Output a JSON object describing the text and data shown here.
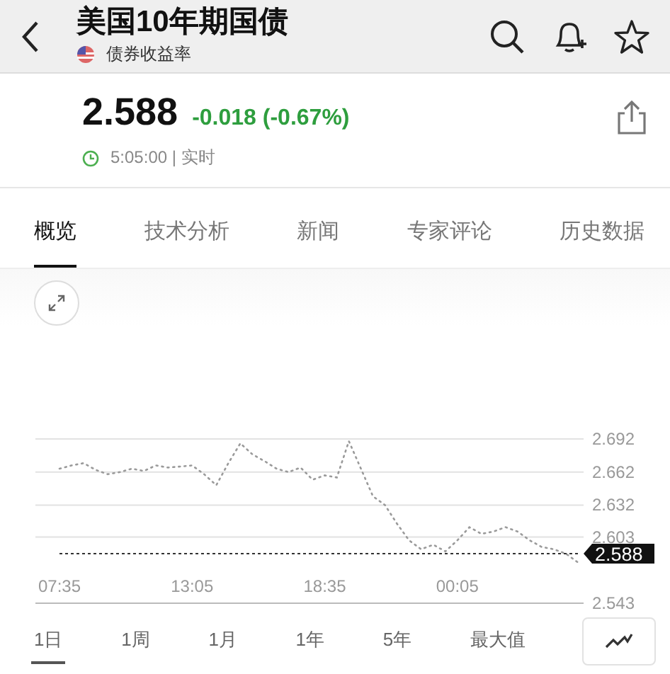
{
  "header": {
    "title": "美国10年期国债",
    "subtitle": "债券收益率"
  },
  "quote": {
    "price": "2.588",
    "change": "-0.018 (-0.67%)",
    "time": "5:05:00 | 实时"
  },
  "tabs": [
    {
      "label": "概览",
      "selected": true
    },
    {
      "label": "技术分析",
      "selected": false
    },
    {
      "label": "新闻",
      "selected": false
    },
    {
      "label": "专家评论",
      "selected": false
    },
    {
      "label": "历史数据",
      "selected": false
    }
  ],
  "chart_data": {
    "type": "line",
    "grid": true,
    "categories": [
      "07:35",
      null,
      null,
      null,
      null,
      null,
      null,
      null,
      null,
      null,
      null,
      "13:05",
      null,
      null,
      null,
      null,
      null,
      null,
      null,
      null,
      null,
      null,
      "18:35",
      null,
      null,
      null,
      null,
      null,
      null,
      null,
      null,
      null,
      null,
      "00:05",
      null,
      null,
      null,
      null,
      null,
      null,
      null,
      null,
      null,
      null
    ],
    "series": [
      {
        "color": "#9a9a9a",
        "line_style": "dotted",
        "values": [
          2.665,
          2.668,
          2.67,
          2.664,
          2.66,
          2.662,
          2.665,
          2.663,
          2.668,
          2.666,
          2.667,
          2.668,
          2.66,
          2.65,
          2.67,
          2.688,
          2.678,
          2.672,
          2.665,
          2.662,
          2.666,
          2.655,
          2.659,
          2.657,
          2.69,
          2.665,
          2.64,
          2.632,
          2.615,
          2.6,
          2.592,
          2.596,
          2.59,
          2.6,
          2.612,
          2.606,
          2.608,
          2.612,
          2.608,
          2.6,
          2.594,
          2.592,
          2.588,
          2.58
        ]
      },
      {
        "color": "#333333",
        "line_style": "dashed",
        "values": [
          2.588,
          2.588,
          2.588,
          2.588,
          2.588,
          2.588,
          2.588,
          2.588,
          2.588,
          2.588,
          2.588,
          2.588,
          2.588,
          2.588,
          2.588,
          2.588,
          2.588,
          2.588,
          2.588,
          2.588,
          2.588,
          2.588,
          2.588,
          2.588,
          2.588,
          2.588,
          2.588,
          2.588,
          2.588,
          2.588,
          2.588,
          2.588,
          2.588,
          2.588,
          2.588,
          2.588,
          2.588,
          2.588,
          2.588,
          2.588,
          2.588,
          2.588,
          2.588,
          2.588
        ]
      }
    ],
    "ylim": [
      2.543,
      2.692
    ],
    "yticks": [
      2.692,
      2.662,
      2.632,
      2.603,
      2.543
    ]
  },
  "current_marker": "2.588",
  "periods": [
    {
      "label": "1日",
      "selected": true
    },
    {
      "label": "1周",
      "selected": false
    },
    {
      "label": "1月",
      "selected": false
    },
    {
      "label": "1年",
      "selected": false
    },
    {
      "label": "5年",
      "selected": false
    },
    {
      "label": "最大值",
      "selected": false
    }
  ]
}
